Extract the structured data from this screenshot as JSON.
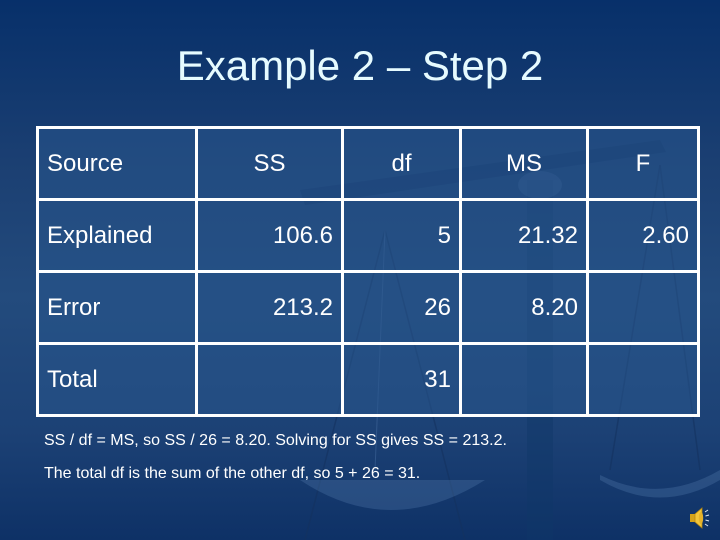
{
  "slide": {
    "title": "Example 2 – Step 2"
  },
  "table": {
    "headers": [
      "Source",
      "SS",
      "df",
      "MS",
      "F"
    ],
    "rows": [
      {
        "source": "Explained",
        "ss": "106.6",
        "df": "5",
        "ms": "21.32",
        "f": "2.60"
      },
      {
        "source": "Error",
        "ss": "213.2",
        "df": "26",
        "ms": "8.20",
        "f": ""
      },
      {
        "source": "Total",
        "ss": "",
        "df": "31",
        "ms": "",
        "f": ""
      }
    ]
  },
  "notes": [
    "SS / df = MS, so SS / 26 = 8.20.  Solving for SS gives SS = 213.2.",
    "The total df is the sum of the other df, so 5 + 26 = 31."
  ],
  "icons": {
    "audio": "speaker-icon"
  },
  "colors": {
    "background_top": "#07306a",
    "background_mid": "#234b7d",
    "title_text": "#e6fbff",
    "table_border": "#ffffff",
    "text": "#ffffff"
  }
}
